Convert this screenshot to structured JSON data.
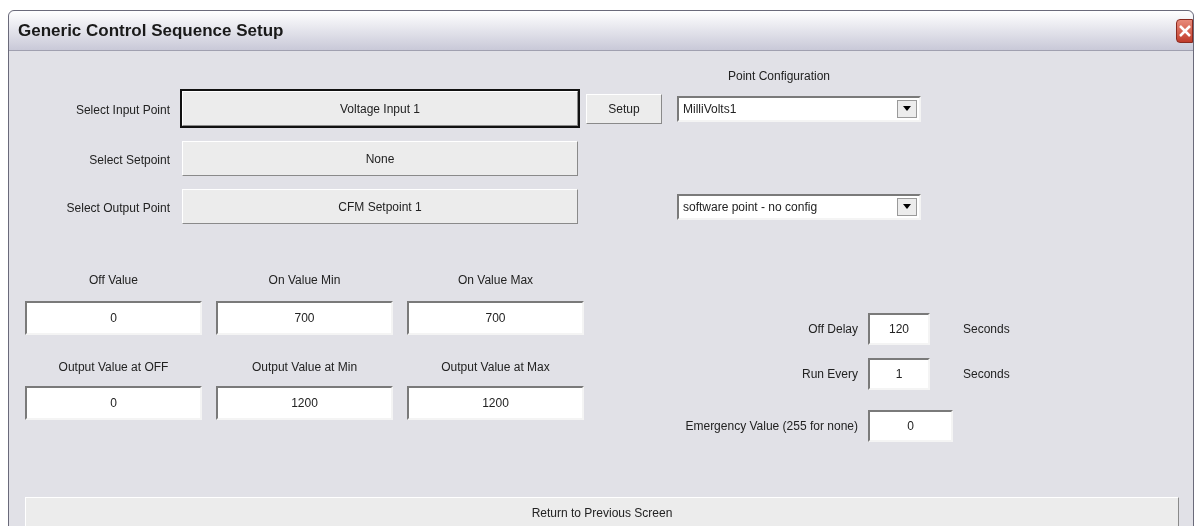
{
  "window": {
    "title": "Generic Control Sequence Setup"
  },
  "point_configuration_label": "Point Configuration",
  "selectors": [
    {
      "label": "Select Input Point",
      "value": "Voltage Input 1",
      "focused": true,
      "setup_button": "Setup",
      "config": "MilliVolts1"
    },
    {
      "label": "Select Setpoint",
      "value": "None",
      "focused": false
    },
    {
      "label": "Select Output Point",
      "value": "CFM Setpoint 1",
      "focused": false,
      "config": "software point - no config"
    }
  ],
  "value_rows": [
    [
      {
        "label": "Off Value",
        "value": "0"
      },
      {
        "label": "On Value Min",
        "value": "700"
      },
      {
        "label": "On Value Max",
        "value": "700"
      }
    ],
    [
      {
        "label": "Output Value at OFF",
        "value": "0"
      },
      {
        "label": "Output Value at Min",
        "value": "1200"
      },
      {
        "label": "Output Value at Max",
        "value": "1200"
      }
    ]
  ],
  "timing": [
    {
      "label": "Off Delay",
      "value": "120",
      "unit": "Seconds"
    },
    {
      "label": "Run Every",
      "value": "1",
      "unit": "Seconds"
    },
    {
      "label": "Emergency Value (255 for none)",
      "value": "0"
    }
  ],
  "return_button": "Return to Previous Screen"
}
